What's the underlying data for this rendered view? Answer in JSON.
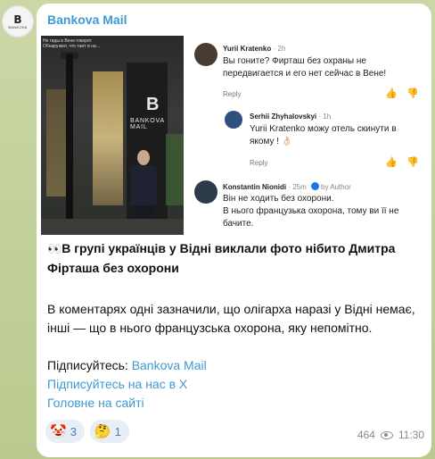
{
  "channel": {
    "name": "Bankova Mail",
    "avatar_letter": "B",
    "avatar_text": "BANKOVA"
  },
  "photo": {
    "caption_line1": "Не гиды в Вене говорят",
    "caption_line2": "Обнаружил, что таит и на…",
    "sign_letter": "B",
    "sign_text": "BANKOVA MAIL"
  },
  "comments": [
    {
      "author": "Yurii Kratenko",
      "time": "2h",
      "text": "Вы гоните? Фирташ без охраны не передвигается и его нет сейчас в Вене!",
      "reply": "Reply"
    },
    {
      "author": "Serhii Zhyhalovskyi",
      "time": "1h",
      "text": "Yurii Kratenko можу отель скинути в якому ! 👌🏻",
      "reply": "Reply"
    },
    {
      "author": "Konstantin Nionidi",
      "time": "25m",
      "by_label": "by Author",
      "text_line1": "Він не ходить без охорони.",
      "text_line2": "В нього французька охорона, тому ви її не бачите."
    }
  ],
  "post": {
    "emoji": "👀",
    "title": "В групі українців у Відні виклали фото нібито Дмитра Фірташа без охорони",
    "paragraph": "В коментарях одні зазначили, що олігарха наразі у Відні немає, інші — що в нього французська охорона, яку непомітно.",
    "subscribe_label": "Підписуйтесь: ",
    "subscribe_link": "Bankova Mail",
    "link_x": "Підписуйтесь на нас в X",
    "link_site": "Головне на сайті"
  },
  "reactions": [
    {
      "emoji": "🤡",
      "count": "3"
    },
    {
      "emoji": "🤔",
      "count": "1"
    }
  ],
  "meta": {
    "views": "464",
    "time": "11:30"
  }
}
